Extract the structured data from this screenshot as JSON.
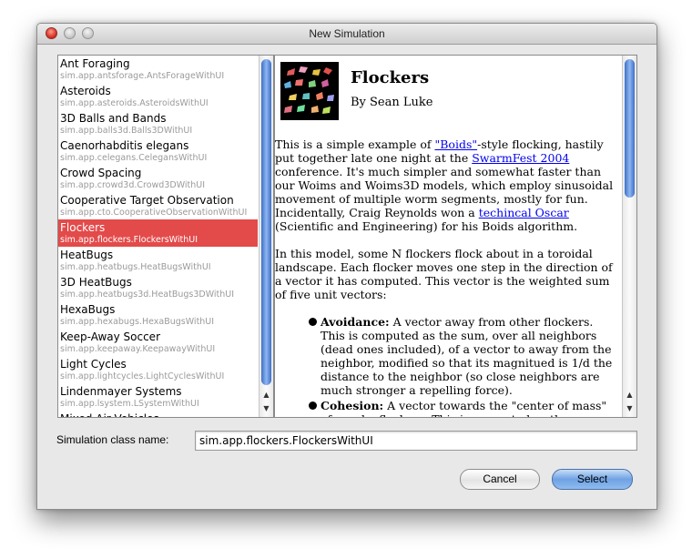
{
  "window": {
    "title": "New Simulation"
  },
  "list": {
    "selected_index": 6,
    "items": [
      {
        "name": "Ant Foraging",
        "cls": "sim.app.antsforage.AntsForageWithUI"
      },
      {
        "name": "Asteroids",
        "cls": "sim.app.asteroids.AsteroidsWithUI"
      },
      {
        "name": "3D Balls and Bands",
        "cls": "sim.app.balls3d.Balls3DWithUI"
      },
      {
        "name": "Caenorhabditis elegans",
        "cls": "sim.app.celegans.CelegansWithUI"
      },
      {
        "name": "Crowd Spacing",
        "cls": "sim.app.crowd3d.Crowd3DWithUI"
      },
      {
        "name": "Cooperative Target Observation",
        "cls": "sim.app.cto.CooperativeObservationWithUI"
      },
      {
        "name": "Flockers",
        "cls": "sim.app.flockers.FlockersWithUI"
      },
      {
        "name": "HeatBugs",
        "cls": "sim.app.heatbugs.HeatBugsWithUI"
      },
      {
        "name": "3D HeatBugs",
        "cls": "sim.app.heatbugs3d.HeatBugs3DWithUI"
      },
      {
        "name": "HexaBugs",
        "cls": "sim.app.hexabugs.HexaBugsWithUI"
      },
      {
        "name": "Keep-Away Soccer",
        "cls": "sim.app.keepaway.KeepawayWithUI"
      },
      {
        "name": "Light Cycles",
        "cls": "sim.app.lightcycles.LightCyclesWithUI"
      },
      {
        "name": "Lindenmayer Systems",
        "cls": "sim.app.lsystem.LSystemWithUI"
      },
      {
        "name": "Mixed Air Vehicles",
        "cls": ""
      }
    ]
  },
  "doc": {
    "title": "Flockers",
    "author": "By Sean Luke",
    "p1_a": "This is a simple example of ",
    "link_boids": "\"Boids\"",
    "p1_b": "-style flocking, hastily put together late one night at the ",
    "link_swarmfest": "SwarmFest 2004",
    "p1_c": " conference. It's much simpler and somewhat faster than our Woims and Woims3D models, which employ sinusoidal movement of multiple worm segments, mostly for fun. Incidentally, Craig Reynolds won a ",
    "link_oscar": "techincal Oscar",
    "p1_d": " (Scientific and Engineering) for his Boids algorithm.",
    "p2": "In this model, some N flockers flock about in a toroidal landscape. Each flocker moves one step in the direction of a vector it has computed. This vector is the weighted sum of five unit vectors:",
    "bullets": [
      {
        "term": "Avoidance:",
        "text": " A vector away from other flockers. This is computed as the sum, over all neighbors (dead ones included), of a vector to away from the neighbor, modified so that its magnitued is 1/d the distance to the neighbor (so close neighbors are much stronger a repelling force)."
      },
      {
        "term": "Cohesion:",
        "text": " A vector towards the \"center of mass\" of nearby flockers. This is computed as the sum, over all live neighbors, of a vector towards the neighbor."
      }
    ]
  },
  "footer": {
    "class_label": "Simulation class name:",
    "class_value": "sim.app.flockers.FlockersWithUI",
    "cancel_label": "Cancel",
    "select_label": "Select"
  },
  "colors": {
    "selection": "#e34a4a",
    "scroll_thumb": "#5b8de0",
    "link": "#0000ee"
  }
}
